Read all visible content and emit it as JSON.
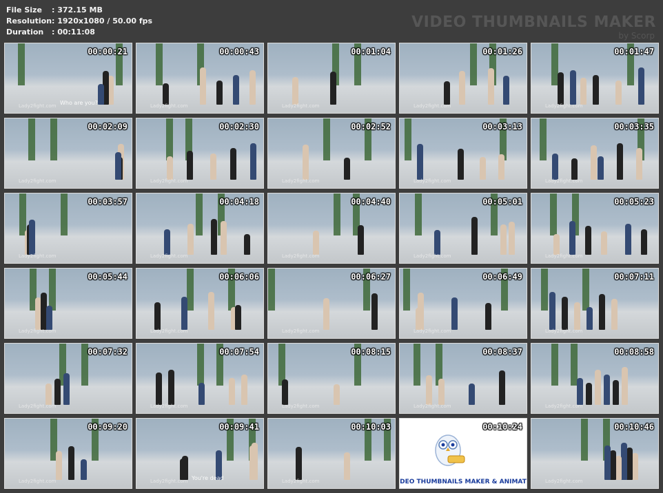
{
  "info": {
    "file_size_label": "File Size",
    "file_size_value": ": 372.15 MB",
    "resolution_label": "Resolution",
    "resolution_value": ": 1920x1080 / 50.00 fps",
    "duration_label": "Duration",
    "duration_value": ": 00:11:08"
  },
  "watermark": {
    "title": "VIDEO THUMBNAILS MAKER",
    "subtitle": "by Scorp"
  },
  "thumbs": [
    {
      "time": "00:00:21",
      "caption": "Who are you?"
    },
    {
      "time": "00:00:43",
      "caption": ""
    },
    {
      "time": "00:01:04",
      "caption": ""
    },
    {
      "time": "00:01:26",
      "caption": ""
    },
    {
      "time": "00:01:47",
      "caption": ""
    },
    {
      "time": "00:02:09",
      "caption": ""
    },
    {
      "time": "00:02:30",
      "caption": ""
    },
    {
      "time": "00:02:52",
      "caption": ""
    },
    {
      "time": "00:03:13",
      "caption": ""
    },
    {
      "time": "00:03:35",
      "caption": ""
    },
    {
      "time": "00:03:57",
      "caption": ""
    },
    {
      "time": "00:04:18",
      "caption": ""
    },
    {
      "time": "00:04:40",
      "caption": ""
    },
    {
      "time": "00:05:01",
      "caption": ""
    },
    {
      "time": "00:05:23",
      "caption": ""
    },
    {
      "time": "00:05:44",
      "caption": ""
    },
    {
      "time": "00:06:06",
      "caption": ""
    },
    {
      "time": "00:06:27",
      "caption": ""
    },
    {
      "time": "00:06:49",
      "caption": ""
    },
    {
      "time": "00:07:11",
      "caption": ""
    },
    {
      "time": "00:07:32",
      "caption": ""
    },
    {
      "time": "00:07:54",
      "caption": ""
    },
    {
      "time": "00:08:15",
      "caption": ""
    },
    {
      "time": "00:08:37",
      "caption": ""
    },
    {
      "time": "00:08:58",
      "caption": ""
    },
    {
      "time": "00:09:20",
      "caption": ""
    },
    {
      "time": "00:09:41",
      "caption": "You're dead"
    },
    {
      "time": "00:10:03",
      "caption": ""
    },
    {
      "time": "00:10:24",
      "caption": "",
      "logo": true
    },
    {
      "time": "00:10:46",
      "caption": ""
    }
  ],
  "site_watermark": "Lady2fight.com",
  "logo_text": "DEO THUMBNAILS MAKER & ANIMAT",
  "colors": {
    "background": "#3d3d3d",
    "info_text": "#f2f2f2",
    "watermark_text": "#565656",
    "logo_text": "#1a3c9c"
  }
}
